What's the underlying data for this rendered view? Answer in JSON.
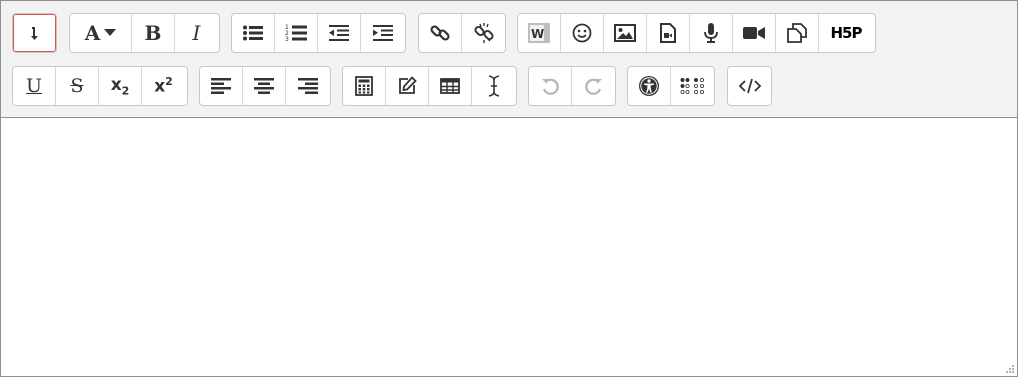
{
  "toolbar": {
    "row1": {
      "show_more_icon": "arrow-down-icon",
      "font_color_label": "A",
      "bold_label": "B",
      "italic_label": "I",
      "h5p_label": "H5P"
    },
    "row2": {
      "underline_label": "U",
      "strikethrough_label": "S",
      "subscript_label": "x",
      "subscript_sub": "2",
      "superscript_label": "x",
      "superscript_sup": "2"
    }
  },
  "colors": {
    "toolbar_bg": "#f2f2f2",
    "button_bg": "#ffffff",
    "icon": "#333333",
    "disabled_icon": "#b6b6b6",
    "active_border": "#d9534f"
  },
  "editor": {
    "content": ""
  }
}
